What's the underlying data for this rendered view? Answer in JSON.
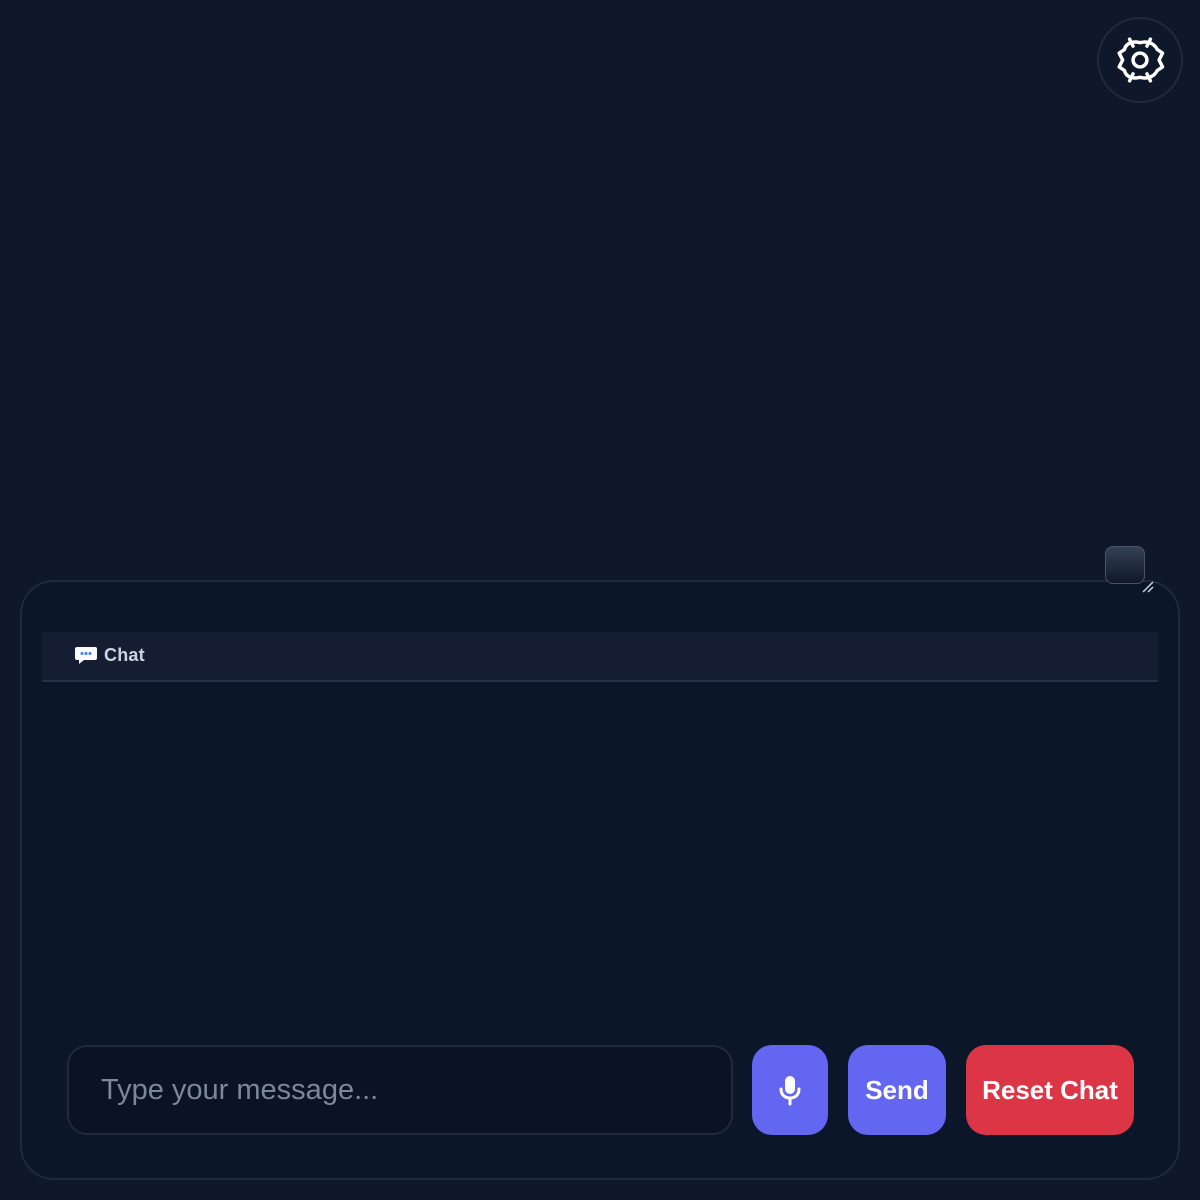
{
  "icons": {
    "settings": "gear-icon",
    "chat": "speech-bubble-icon",
    "microphone": "microphone-icon",
    "resize": "resize-handle-icon"
  },
  "chat_panel": {
    "title": "Chat",
    "input": {
      "value": "",
      "placeholder": "Type your message..."
    },
    "buttons": {
      "send_label": "Send",
      "reset_label": "Reset Chat"
    }
  },
  "colors": {
    "background": "#0f172a",
    "panel": "#0c1629",
    "header": "#141d31",
    "accent": "#6366f1",
    "danger": "#dc3545"
  }
}
